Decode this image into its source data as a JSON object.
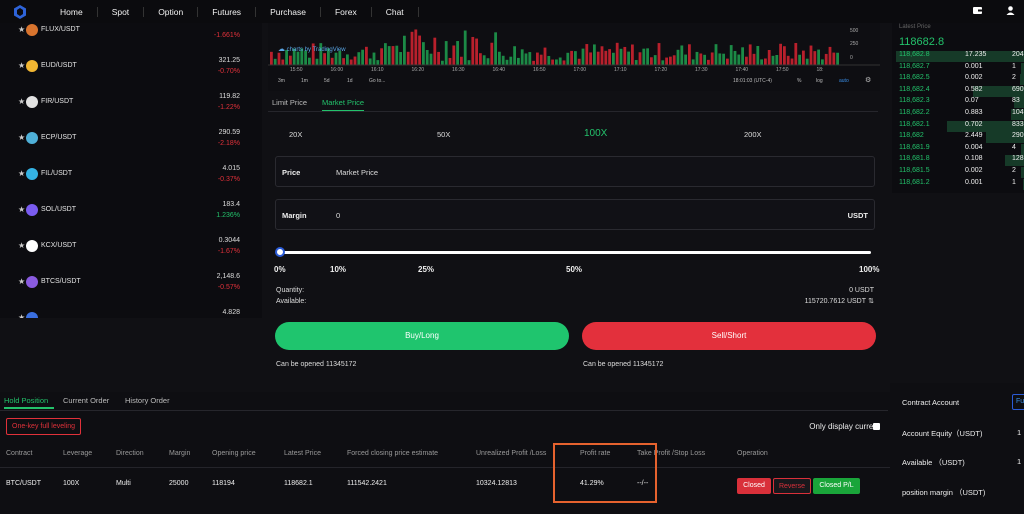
{
  "nav": {
    "items": [
      "Home",
      "Spot",
      "Option",
      "Futures",
      "Purchase",
      "Forex",
      "Chat"
    ]
  },
  "pairs": [
    {
      "name": "FLUX/USDT",
      "price": "",
      "change": "-1.661%",
      "dir": "down",
      "coin_color": "#d9742e"
    },
    {
      "name": "EUD/USDT",
      "price": "321.25",
      "change": "-0.70%",
      "dir": "down",
      "coin_color": "#f2b632"
    },
    {
      "name": "FIR/USDT",
      "price": "119.82",
      "change": "-1.22%",
      "dir": "down",
      "coin_color": "#e2e2e2"
    },
    {
      "name": "ECP/USDT",
      "price": "290.59",
      "change": "-2.18%",
      "dir": "down",
      "coin_color": "#4fb0d8"
    },
    {
      "name": "FIL/USDT",
      "price": "4.015",
      "change": "-0.37%",
      "dir": "down",
      "coin_color": "#34b3e4"
    },
    {
      "name": "SOL/USDT",
      "price": "183.4",
      "change": "1.236%",
      "dir": "up",
      "coin_color": "#7a5cf0"
    },
    {
      "name": "KCX/USDT",
      "price": "0.3044",
      "change": "-1.67%",
      "dir": "down",
      "coin_color": "#ffffff"
    },
    {
      "name": "BTCS/USDT",
      "price": "2,148.6",
      "change": "-0.57%",
      "dir": "down",
      "coin_color": "#8a5be0"
    },
    {
      "name": "",
      "price": "4.828",
      "change": "",
      "dir": "down",
      "coin_color": "#3a6fe0"
    }
  ],
  "chart": {
    "watermark": "charts by TradingView",
    "axis_labels": [
      "500",
      "250",
      "0"
    ],
    "times": [
      "15:50",
      "16:00",
      "16:10",
      "16:20",
      "16:30",
      "16:40",
      "16:50",
      "17:00",
      "17:10",
      "17:20",
      "17:30",
      "17:40",
      "17:50",
      "18:"
    ],
    "ranges": [
      "3m",
      "1m",
      "5d",
      "1d",
      "Go to..."
    ],
    "clock": "18:01:03 (UTC-4)",
    "opts": [
      "%",
      "log",
      "auto"
    ]
  },
  "order_form": {
    "tab_limit": "Limit Price",
    "tab_market": "Market Price",
    "leverages": [
      "20X",
      "50X",
      "100X",
      "200X"
    ],
    "price_label": "Price",
    "price_value": "Market Price",
    "margin_label": "Margin",
    "margin_value": "0",
    "margin_unit": "USDT",
    "percents": [
      "0%",
      "10%",
      "25%",
      "50%",
      "100%"
    ],
    "quantity_label": "Quantity:",
    "quantity_value": "0 USDT",
    "available_label": "Available:",
    "available_value": "115720.7612 USDT",
    "buy_label": "Buy/Long",
    "sell_label": "Sell/Short",
    "can_open_buy": "Can be opened 11345172",
    "can_open_sell": "Can be opened 11345172"
  },
  "order_book": {
    "title": "Latest Price",
    "last": "118682.8",
    "rows": [
      {
        "price": "118,682.8",
        "qty": "17.235",
        "total": "204"
      },
      {
        "price": "118,682.7",
        "qty": "0.001",
        "total": "1"
      },
      {
        "price": "118,682.5",
        "qty": "0.002",
        "total": "2"
      },
      {
        "price": "118,682.4",
        "qty": "0.582",
        "total": "690"
      },
      {
        "price": "118,682.3",
        "qty": "0.07",
        "total": "83"
      },
      {
        "price": "118,682.2",
        "qty": "0.883",
        "total": "104"
      },
      {
        "price": "118,682.1",
        "qty": "0.702",
        "total": "833"
      },
      {
        "price": "118,682",
        "qty": "2.449",
        "total": "290"
      },
      {
        "price": "118,681.9",
        "qty": "0.004",
        "total": "4"
      },
      {
        "price": "118,681.8",
        "qty": "0.108",
        "total": "128"
      },
      {
        "price": "118,681.5",
        "qty": "0.002",
        "total": "2"
      },
      {
        "price": "118,681.2",
        "qty": "0.001",
        "total": "1"
      }
    ]
  },
  "positions": {
    "tabs": [
      "Hold Position",
      "Current Order",
      "History Order"
    ],
    "one_key": "One-key full leveling",
    "only_display": "Only display current",
    "headers": [
      "Contract",
      "Leverage",
      "Direction",
      "Margin",
      "Opening price",
      "Latest Price",
      "Forced closing price estimate",
      "Unrealized Profit /Loss",
      "Profit rate",
      "Take Profit /Stop Loss",
      "Operation"
    ],
    "row": {
      "contract": "BTC/USDT",
      "leverage": "100X",
      "direction": "Multi",
      "margin": "25000",
      "opening": "118194",
      "latest": "118682.1",
      "forced": "111542.2421",
      "pnl": "10324.12813",
      "rate": "41.29%",
      "tpsl": "--/--",
      "btn_closed": "Closed",
      "btn_reverse": "Reverse",
      "btn_closed_pl": "Closed P/L"
    }
  },
  "contract_account": {
    "title": "Contract Account",
    "btn": "Fu",
    "equity_label": "Account Equity（USDT)",
    "equity_value": "1",
    "available_label": "Available （USDT)",
    "available_value": "1",
    "margin_label": "position margin （USDT)"
  }
}
